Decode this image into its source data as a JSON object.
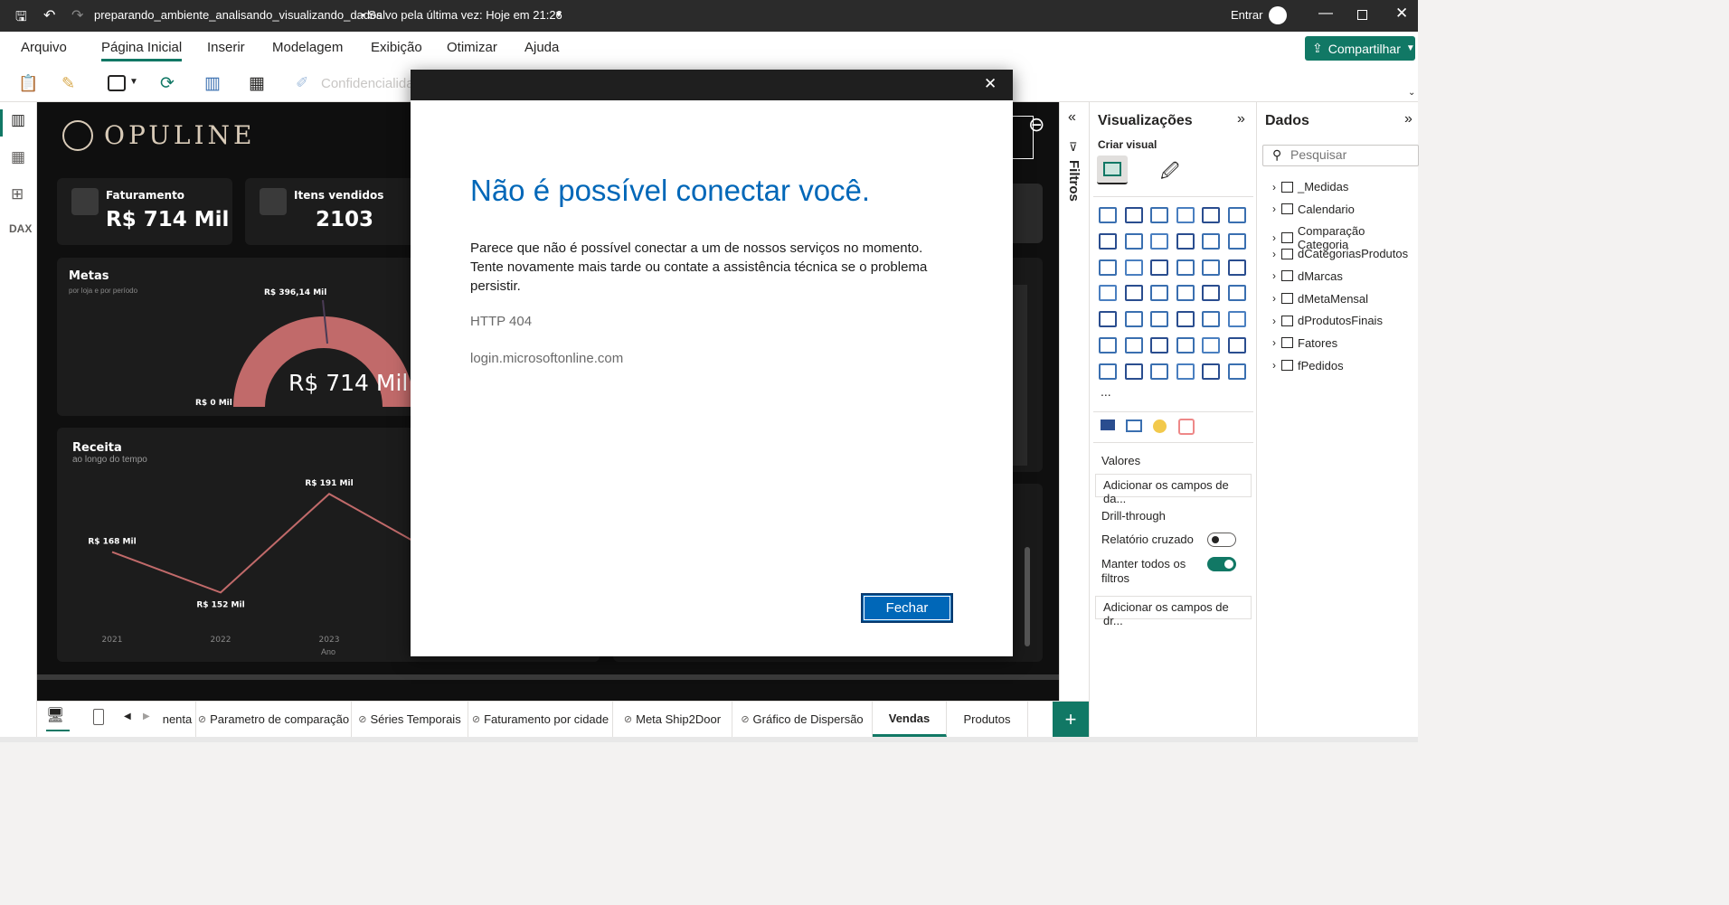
{
  "titlebar": {
    "file_name": "preparando_ambiente_analisando_visualizando_dados",
    "save_status": "• Salvo pela última vez: Hoje em 21:26",
    "signin_label": "Entrar"
  },
  "menu": {
    "items": [
      "Arquivo",
      "Página Inicial",
      "Inserir",
      "Modelagem",
      "Exibição",
      "Otimizar",
      "Ajuda"
    ],
    "share_label": "Compartilhar"
  },
  "toolbar": {
    "sensitivity_label": "Confidencialida"
  },
  "report": {
    "brand": "OPULINE",
    "kpi1_label": "Faturamento",
    "kpi1_value": "R$ 714 Mil",
    "kpi2_label": "Itens vendidos",
    "kpi2_value": "2103",
    "metas_title": "Metas",
    "metas_subtitle": "por loja e por período",
    "gauge_max_label": "R$ 396,14 Mil",
    "gauge_min_label": "R$ 0 Mil",
    "gauge_value": "R$ 714 Mil",
    "receita_title": "Receita",
    "receita_subtitle": "ao longo do tempo",
    "receita_xlabel": "Ano"
  },
  "chart_data": {
    "type": "line",
    "title": "Receita",
    "subtitle": "ao longo do tempo",
    "xlabel": "Ano",
    "x": [
      "2021",
      "2022",
      "2023"
    ],
    "series": [
      {
        "values": [
          168,
          152,
          191
        ],
        "labels": [
          "R$ 168 Mil",
          "R$ 152 Mil",
          "R$ 191 Mil"
        ]
      }
    ]
  },
  "filters": {
    "label": "Filtros"
  },
  "visualizations": {
    "title": "Visualizações",
    "create_visual": "Criar visual",
    "values_label": "Valores",
    "values_placeholder": "Adicionar os campos de da...",
    "drillthrough_label": "Drill-through",
    "cross_report_label": "Relatório cruzado",
    "keep_filters_label": "Manter todos os filtros",
    "drill_placeholder": "Adicionar os campos de dr...",
    "more": "..."
  },
  "data_pane": {
    "title": "Dados",
    "search_placeholder": "Pesquisar",
    "tables": [
      "_Medidas",
      "Calendario",
      "Comparação Categoria",
      "dCategoriasProdutos",
      "dMarcas",
      "dMetaMensal",
      "dProdutosFinais",
      "Fatores",
      "fPedidos"
    ]
  },
  "tabs": {
    "items": [
      "nenta",
      "Parametro de comparação",
      "Séries Temporais",
      "Faturamento por cidade",
      "Meta Ship2Door",
      "Gráfico de Dispersão",
      "Vendas",
      "Produtos"
    ],
    "active": "Vendas",
    "add": "+"
  },
  "dialog": {
    "heading": "Não é possível conectar você.",
    "message": "Parece que não é possível conectar a um de nossos serviços no momento. Tente novamente mais tarde ou contate a assistência técnica se o problema persistir.",
    "error_code": "HTTP 404",
    "host": "login.microsoftonline.com",
    "close_button": "Fechar",
    "close_x": "✕"
  },
  "colors": {
    "accent_green": "#117865",
    "dialog_blue": "#0067b8",
    "gauge_rose": "#c16a6a"
  }
}
